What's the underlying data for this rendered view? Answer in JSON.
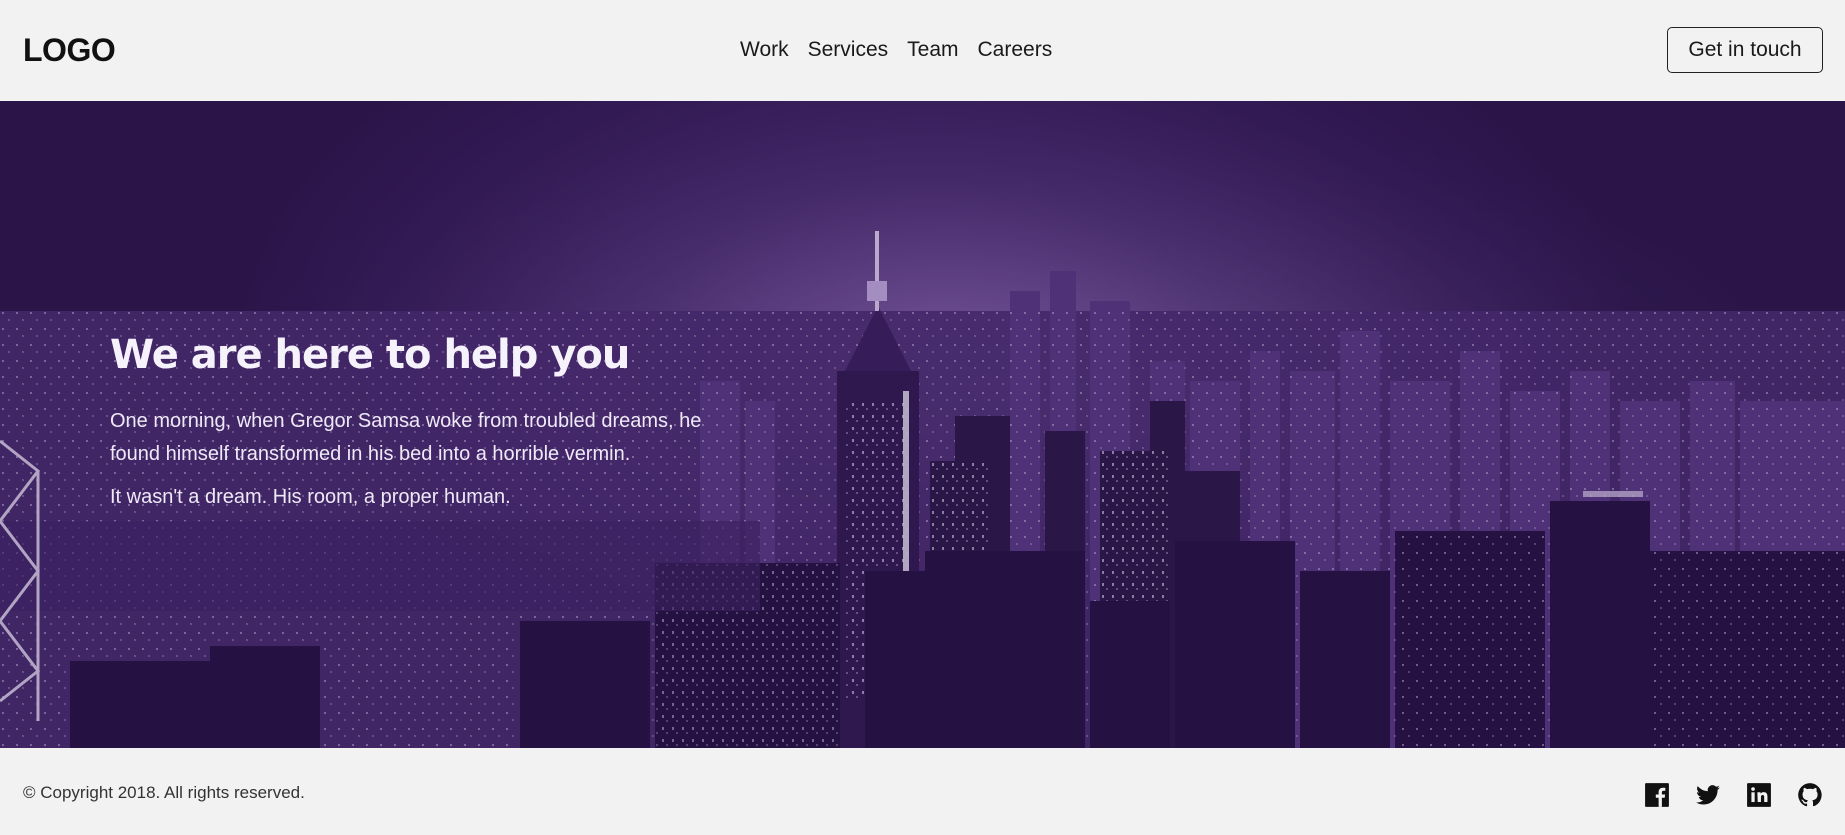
{
  "header": {
    "logo": "LOGO",
    "nav": [
      "Work",
      "Services",
      "Team",
      "Careers"
    ],
    "cta_label": "Get in touch"
  },
  "hero": {
    "title": "We are here to help you",
    "paragraph1": "One morning, when Gregor Samsa woke from troubled dreams, he found himself transformed in his bed into a horrible vermin.",
    "paragraph2": "It wasn't a dream. His room, a proper human.",
    "background_icon": "night-city-skyline-image",
    "overlay_color": "#3b2163"
  },
  "footer": {
    "copyright": "© Copyright 2018. All rights reserved.",
    "social_icons": [
      "facebook-icon",
      "twitter-icon",
      "linkedin-icon",
      "github-icon"
    ]
  },
  "colors": {
    "page_bg": "#f2f2f2",
    "text": "#111111",
    "hero_purple": "#341c58"
  }
}
